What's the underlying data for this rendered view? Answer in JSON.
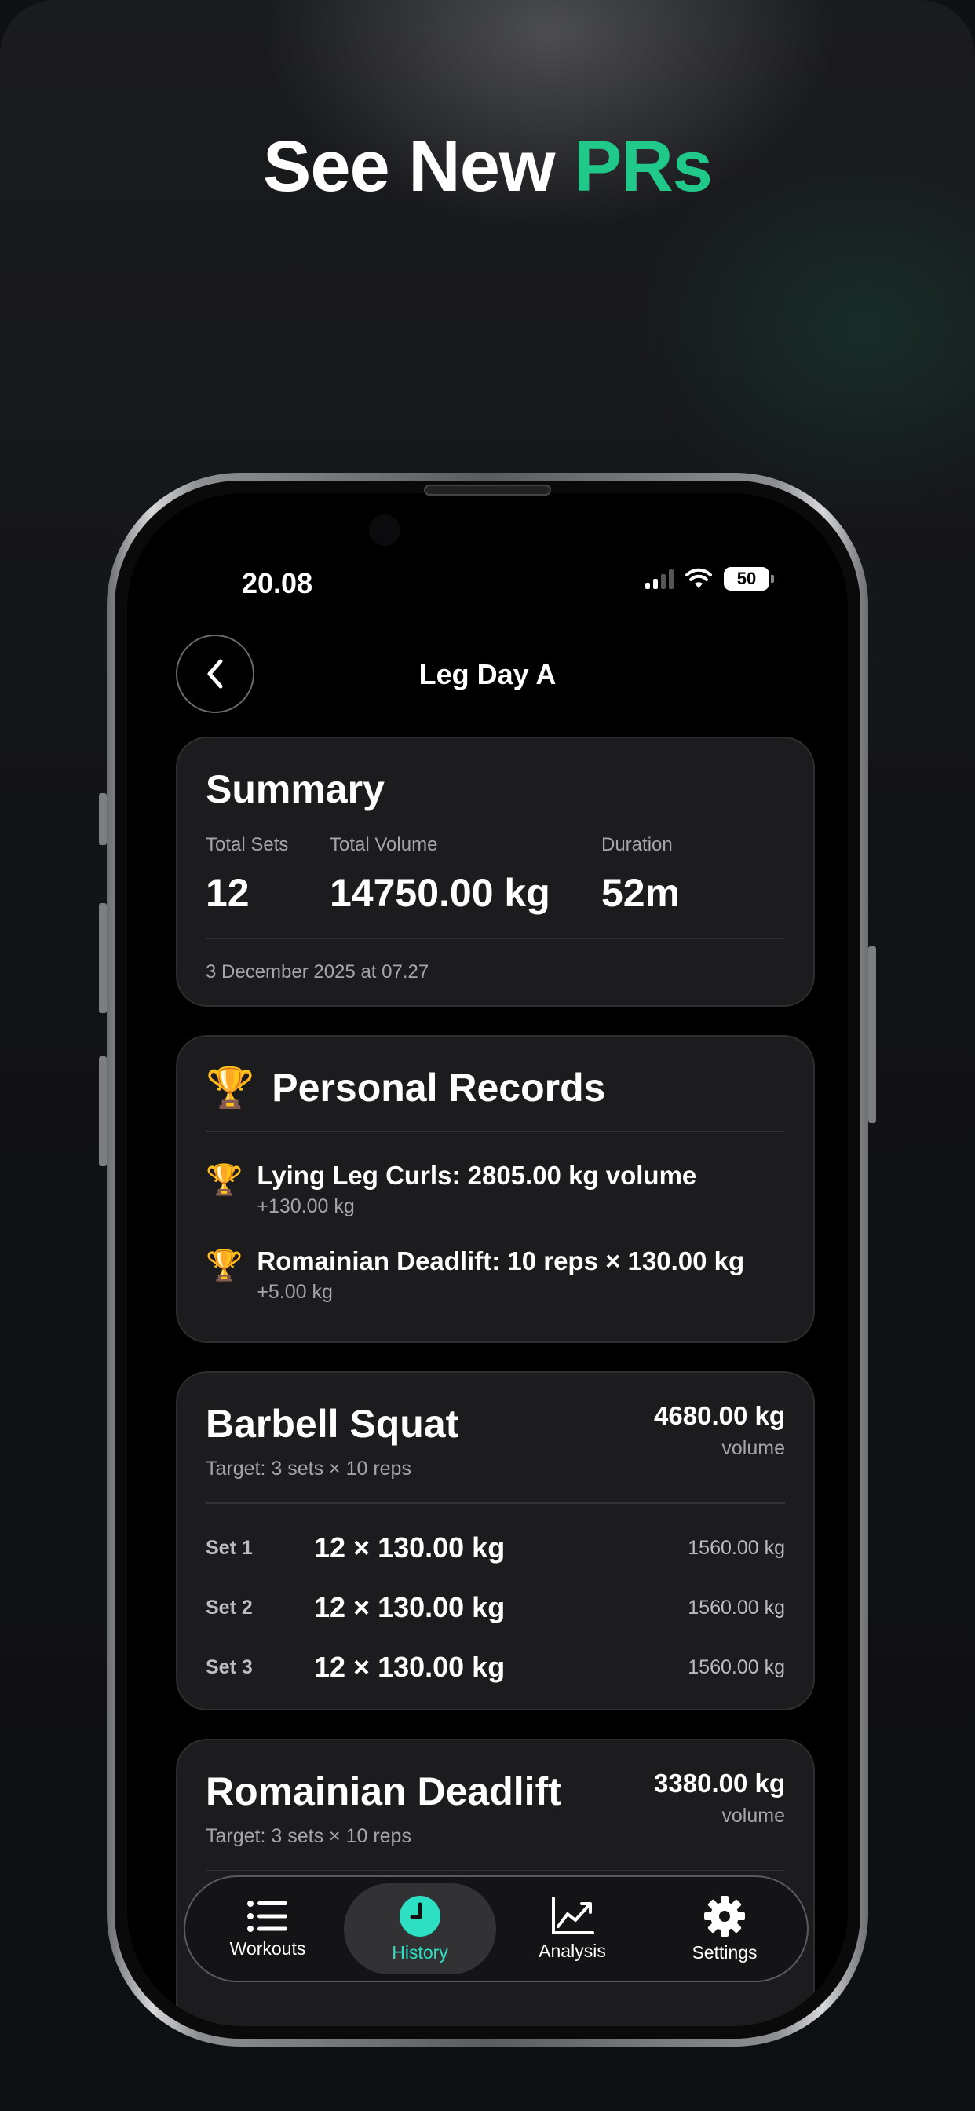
{
  "headline": {
    "part1": "See New",
    "part2": "PRs",
    "accent_color": "#20c889"
  },
  "status_bar": {
    "time": "20.08",
    "battery": "50"
  },
  "nav": {
    "title": "Leg Day A",
    "back_icon": "chevron-left-icon"
  },
  "summary": {
    "title": "Summary",
    "stats": [
      {
        "label": "Total Sets",
        "value": "12"
      },
      {
        "label": "Total Volume",
        "value": "14750.00 kg"
      },
      {
        "label": "Duration",
        "value": "52m"
      }
    ],
    "date": "3 December 2025 at 07.27"
  },
  "personal_records": {
    "title": "Personal Records",
    "icon": "trophy-icon",
    "items": [
      {
        "title": "Lying Leg Curls: 2805.00 kg volume",
        "delta": "+130.00 kg"
      },
      {
        "title": "Romainian Deadlift: 10 reps × 130.00 kg",
        "delta": "+5.00 kg"
      }
    ]
  },
  "exercises": [
    {
      "name": "Barbell Squat",
      "target": "Target: 3 sets × 10 reps",
      "volume": "4680.00 kg",
      "volume_label": "volume",
      "sets": [
        {
          "label": "Set 1",
          "work": "12 × 130.00 kg",
          "volume": "1560.00 kg"
        },
        {
          "label": "Set 2",
          "work": "12 × 130.00 kg",
          "volume": "1560.00 kg"
        },
        {
          "label": "Set 3",
          "work": "12 × 130.00 kg",
          "volume": "1560.00 kg"
        }
      ]
    },
    {
      "name": "Romainian Deadlift",
      "target": "Target: 3 sets × 10 reps",
      "volume": "3380.00 kg",
      "volume_label": "volume"
    }
  ],
  "tabbar": {
    "tabs": [
      {
        "label": "Workouts",
        "icon": "list-icon",
        "active": false
      },
      {
        "label": "History",
        "icon": "clock-icon",
        "active": true
      },
      {
        "label": "Analysis",
        "icon": "chart-line-icon",
        "active": false
      },
      {
        "label": "Settings",
        "icon": "gear-icon",
        "active": false
      }
    ],
    "active_color": "#2de0c4"
  }
}
